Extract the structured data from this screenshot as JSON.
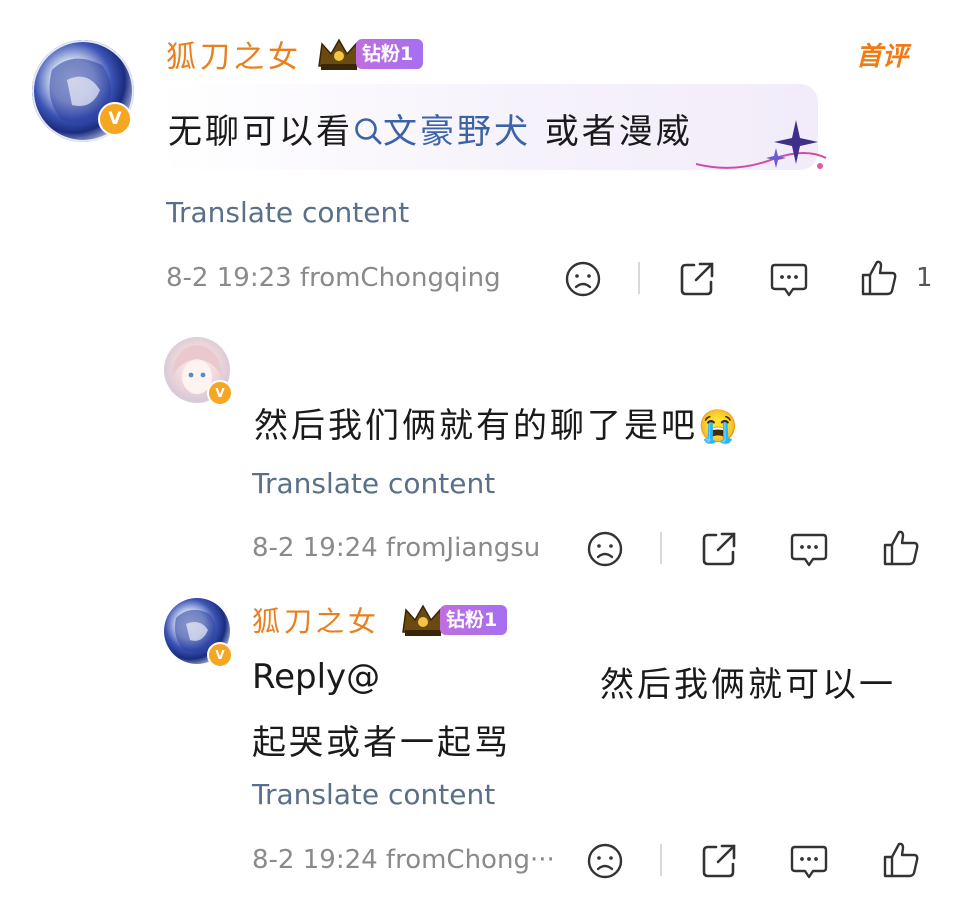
{
  "comment": {
    "username": "狐刀之女",
    "fan_badge": "钻粉1",
    "first_tag": "首评",
    "content_before": "无聊可以看",
    "topic_text": "文豪野犬",
    "content_after": " 或者漫威",
    "translate": "Translate content",
    "meta": "8-2 19:23 fromChongqing",
    "like_count": "1"
  },
  "reply1": {
    "content": "然后我们俩就有的聊了是吧",
    "emoji": "😭",
    "translate": "Translate content",
    "meta": "8-2 19:24 fromJiangsu"
  },
  "reply2": {
    "username": "狐刀之女",
    "fan_badge": "钻粉1",
    "reply_prefix": "Reply@",
    "content_line1": "然后我俩就可以一",
    "content_line2": "起哭或者一起骂",
    "translate": "Translate content",
    "meta": "8-2 19:24 fromChong···"
  },
  "colors": {
    "username": "#e8801f",
    "topic": "#3b64a8",
    "translate": "#5a6f89",
    "meta": "#8a8a8a",
    "badge": "#b06ee8",
    "verified": "#f5a623"
  },
  "icons": [
    "dislike-icon",
    "share-icon",
    "comment-icon",
    "like-icon",
    "search-icon",
    "crown-icon",
    "verified-icon"
  ]
}
